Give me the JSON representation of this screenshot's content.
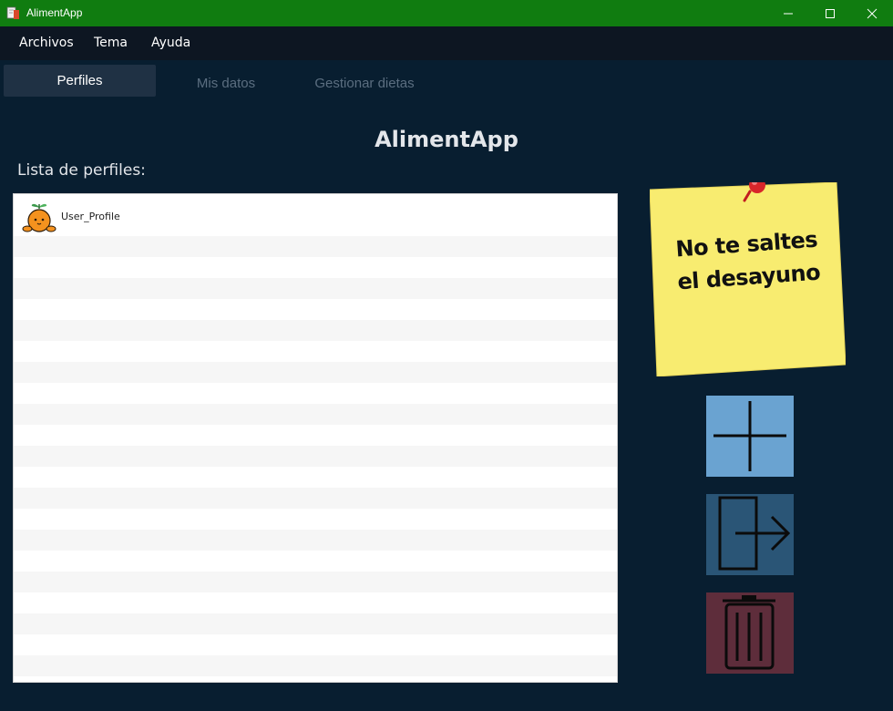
{
  "window": {
    "title": "AlimentApp",
    "controls": [
      "minimize",
      "maximize",
      "close"
    ]
  },
  "menu": {
    "items": [
      "Archivos",
      "Tema",
      "Ayuda"
    ]
  },
  "tabs": [
    {
      "label": "Perfiles",
      "active": true
    },
    {
      "label": "Mis datos",
      "active": false
    },
    {
      "label": "Gestionar dietas",
      "active": false
    }
  ],
  "main": {
    "heading": "AlimentApp",
    "list_label": "Lista de perfiles:",
    "profiles": [
      {
        "name": "User_Profile",
        "avatar": "orange-avatar-icon"
      }
    ]
  },
  "note": {
    "line1": "No te saltes",
    "line2": "el desayuno"
  },
  "actions": [
    {
      "name": "add-profile",
      "icon": "plus-icon",
      "color": "#6aa3d1"
    },
    {
      "name": "login-profile",
      "icon": "enter-door-icon",
      "color": "#2a5576"
    },
    {
      "name": "delete-profile",
      "icon": "trash-icon",
      "color": "#5e2d3b"
    }
  ],
  "colors": {
    "titlebar": "#107c10",
    "menubar": "#0d1622",
    "background": "#081e30",
    "active_tab": "#1f3144"
  }
}
